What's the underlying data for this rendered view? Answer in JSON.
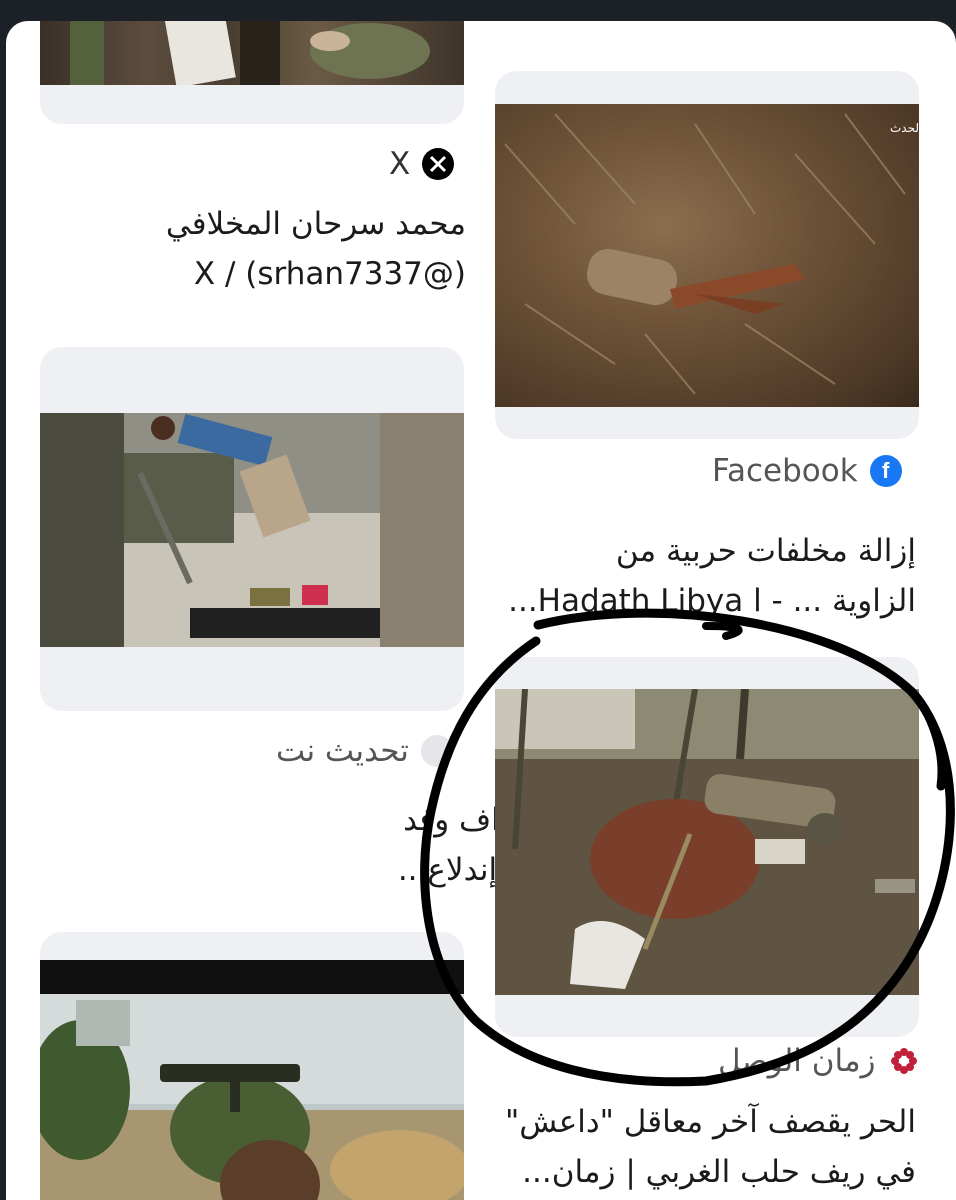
{
  "results": [
    {
      "source": "X",
      "source_icon": "x-logo-icon",
      "title_line1": "محمد سرحان المخلافي",
      "title_line2": "X / (srhan7337@)"
    },
    {
      "source": "Facebook",
      "source_icon": "facebook-icon",
      "title_line1": "إزالة مخلفات حربية من",
      "title_line2": "الزاوية ... - Hadath Libya l..."
    },
    {
      "source": "تحديث نت",
      "source_icon": "site-icon",
      "title_line1": "اخبار وتقارير - إستهداف وفد",
      "title_line2": "زائر يتبع المليشيات وإندلاع..."
    },
    {
      "source": "زمان الوصل",
      "source_icon": "flower-logo-icon",
      "title_line1": "الحر يقصف آخر معاقل \"داعش\"",
      "title_line2": "في ريف حلب الغربي | زمان..."
    }
  ],
  "colors": {
    "facebook_blue": "#1877f2",
    "zaman_red": "#c0203a",
    "circle_annotation": "#000000"
  }
}
